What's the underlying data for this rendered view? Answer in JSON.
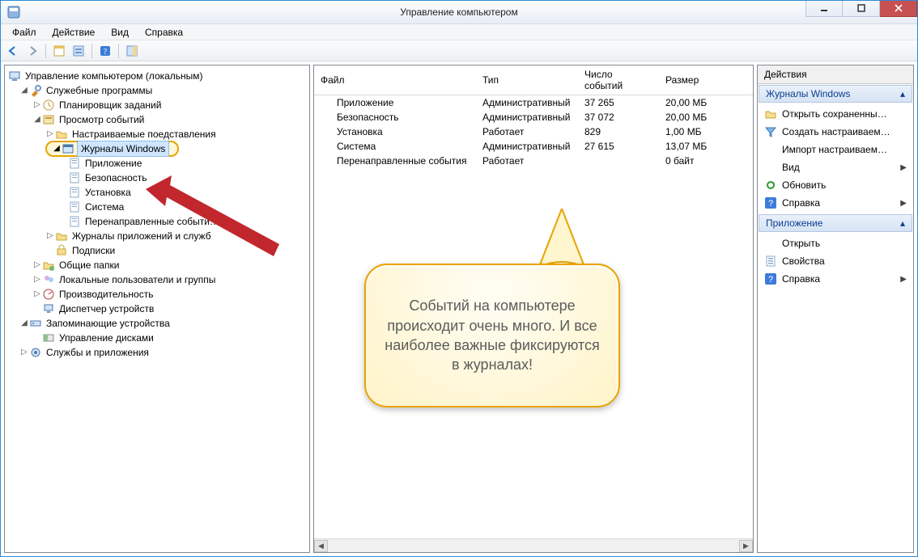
{
  "window": {
    "title": "Управление компьютером"
  },
  "menubar": {
    "items": [
      "Файл",
      "Действие",
      "Вид",
      "Справка"
    ]
  },
  "tree": {
    "root": "Управление компьютером (локальным)",
    "n1": "Служебные программы",
    "n1a": "Планировщик заданий",
    "n1b": "Просмотр событий",
    "n1b1": "Настраиваемые поедставления",
    "n1b2": "Журналы Windows",
    "n1b2a": "Приложение",
    "n1b2b": "Безопасность",
    "n1b2c": "Установка",
    "n1b2d": "Система",
    "n1b2e": "Перенаправленные событи…",
    "n1b3": "Журналы приложений и служб",
    "n1b4": "Подписки",
    "n1c": "Общие папки",
    "n1d": "Локальные пользователи и группы",
    "n1e": "Производительность",
    "n1f": "Диспетчер устройств",
    "n2": "Запоминающие устройства",
    "n2a": "Управление дисками",
    "n3": "Службы и приложения"
  },
  "table": {
    "headers": [
      "Файл",
      "Тип",
      "Число событий",
      "Размер"
    ],
    "rows": [
      {
        "file": "Приложение",
        "type": "Административный",
        "count": "37 265",
        "size": "20,00 МБ"
      },
      {
        "file": "Безопасность",
        "type": "Административный",
        "count": "37 072",
        "size": "20,00 МБ"
      },
      {
        "file": "Установка",
        "type": "Работает",
        "count": "829",
        "size": "1,00 МБ"
      },
      {
        "file": "Система",
        "type": "Административный",
        "count": "27 615",
        "size": "13,07 МБ"
      },
      {
        "file": "Перенаправленные события",
        "type": "Работает",
        "count": "",
        "size": "0 байт"
      }
    ]
  },
  "actions": {
    "header": "Действия",
    "section1": {
      "title": "Журналы Windows",
      "items": [
        {
          "label": "Открыть сохраненны…",
          "icon": "folder"
        },
        {
          "label": "Создать настраиваем…",
          "icon": "filter"
        },
        {
          "label": "Импорт настраиваем…",
          "icon": "blank"
        },
        {
          "label": "Вид",
          "icon": "blank",
          "chevron": true
        },
        {
          "label": "Обновить",
          "icon": "refresh"
        },
        {
          "label": "Справка",
          "icon": "help",
          "chevron": true
        }
      ]
    },
    "section2": {
      "title": "Приложение",
      "items": [
        {
          "label": "Открыть",
          "icon": "blank"
        },
        {
          "label": "Свойства",
          "icon": "props"
        },
        {
          "label": "Справка",
          "icon": "help",
          "chevron": true
        }
      ]
    }
  },
  "callout": {
    "text": "Событий на компьютере происходит очень много. И все наиболее важные фиксируются в журналах!"
  }
}
